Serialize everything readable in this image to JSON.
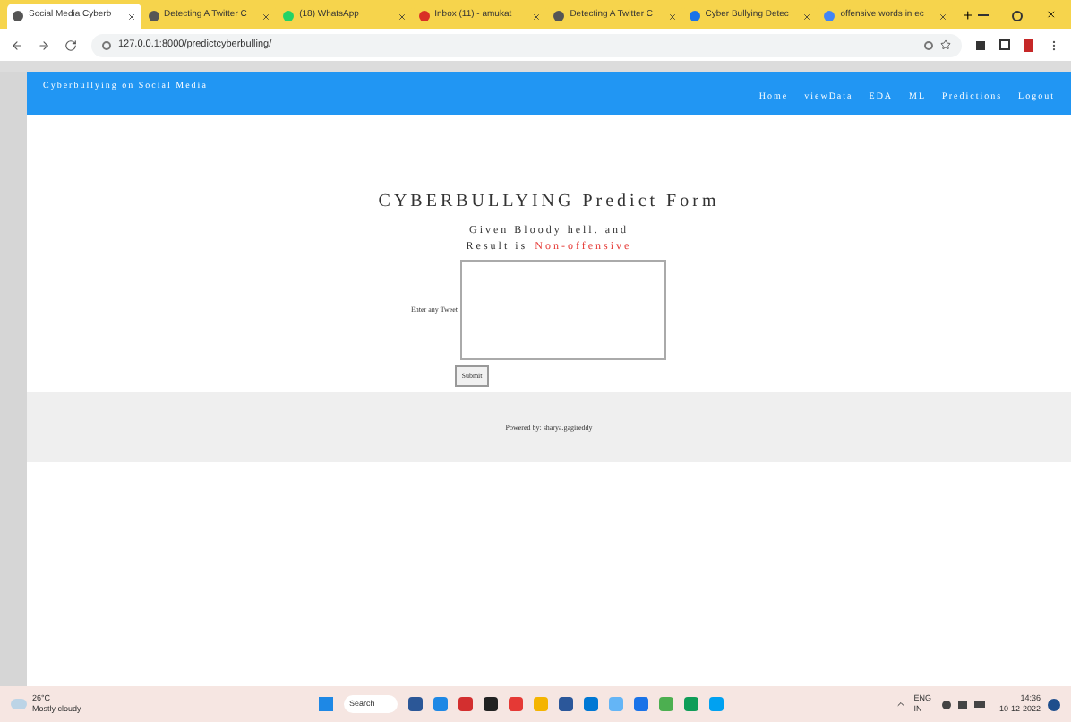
{
  "browser": {
    "tabs": [
      {
        "title": "Social Media Cyberb",
        "selected": true
      },
      {
        "title": "Detecting A Twitter C",
        "selected": false
      },
      {
        "title": "(18) WhatsApp",
        "selected": false
      },
      {
        "title": "Inbox (11) - amukat",
        "selected": false
      },
      {
        "title": "Detecting A Twitter C",
        "selected": false
      },
      {
        "title": "Cyber Bullying Detec",
        "selected": false
      },
      {
        "title": "offensive words in ec",
        "selected": false
      }
    ],
    "url": "127.0.0.1:8000/predictcyberbulling/"
  },
  "navbar": {
    "brand": "Cyberbullying on Social Media",
    "links": [
      "Home",
      "viewData",
      "EDA",
      "ML",
      "Predictions",
      "Logout"
    ]
  },
  "form": {
    "title": "CYBERBULLYING Predict Form",
    "given": "Given Bloody hell. and",
    "result_label": "Result is",
    "result": "Non-offensive",
    "field_label": "Enter any Tweet",
    "submit": "Submit"
  },
  "footer": {
    "text": "Powered by: sharya.gagireddy"
  },
  "taskbar": {
    "temperature": "26°C",
    "weather": "Mostly cloudy",
    "search": "Search",
    "language": "ENG",
    "region": "IN",
    "time": "14:36",
    "date": "10-12-2022"
  }
}
